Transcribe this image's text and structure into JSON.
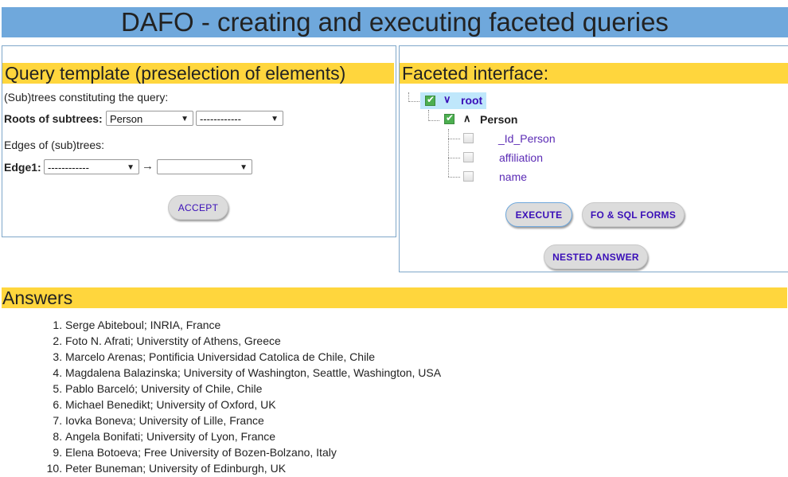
{
  "header": {
    "title": "DAFO - creating and executing faceted queries"
  },
  "query_template": {
    "title": "Query template (preselection of elements)",
    "subtrees_label": "(Sub)trees constituting the query:",
    "roots_label": "Roots of subtrees:",
    "root_select_1": "Person",
    "root_select_2": "------------",
    "edges_label": "Edges of (sub)trees:",
    "edge1_label": "Edge1:",
    "edge1_from": "------------",
    "edge1_arrow": "→",
    "edge1_to": "",
    "accept_button": "ACCEPT"
  },
  "faceted_interface": {
    "title": "Faceted interface:",
    "tree": {
      "root": {
        "label": "root",
        "checked": true,
        "expanded": true
      },
      "person": {
        "label": "Person",
        "checked": true,
        "expanded": true
      },
      "leaves": [
        {
          "label": "_Id_Person",
          "checked": false
        },
        {
          "label": "affiliation",
          "checked": false
        },
        {
          "label": "name",
          "checked": false
        }
      ]
    },
    "execute_button": "EXECUTE",
    "forms_button": "FO & SQL FORMS",
    "nested_button": "NESTED ANSWER"
  },
  "answers": {
    "title": "Answers",
    "items": [
      "Serge Abiteboul; INRIA, France",
      "Foto N. Afrati; Universtity of Athens, Greece",
      "Marcelo Arenas; Pontificia Universidad Catolica de Chile, Chile",
      "Magdalena Balazinska; University of Washington, Seattle, Washington, USA",
      "Pablo Barceló; University of Chile, Chile",
      "Michael Benedikt; University of Oxford, UK",
      "Iovka Boneva; University of Lille, France",
      "Angela Bonifati; University of Lyon, France",
      "Elena Botoeva; Free University of Bozen-Bolzano, Italy",
      "Peter Buneman; University of Edinburgh, UK"
    ]
  },
  "colors": {
    "header_bg": "#6fa8dc",
    "section_title_bg": "#ffd63d",
    "button_text": "#3a0fb8",
    "link_text": "#5b2bb5",
    "root_highlight": "#bfe7fb",
    "checked_green": "#4caf50"
  }
}
